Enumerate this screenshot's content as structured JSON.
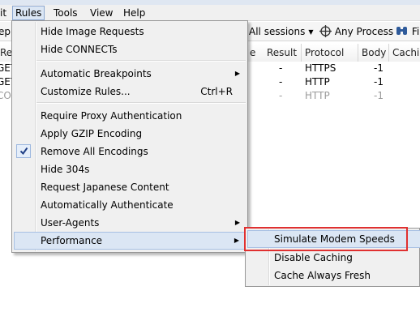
{
  "menubar": {
    "items": [
      {
        "label": "it"
      },
      {
        "label": "Rules"
      },
      {
        "label": "Tools"
      },
      {
        "label": "View"
      },
      {
        "label": "Help"
      }
    ]
  },
  "toolbar": {
    "left_fragment": "epl",
    "sessions_label": "All sessions",
    "any_process_label": "Any Process",
    "find_fragment": "Fi"
  },
  "grid": {
    "columns": [
      {
        "label": "Res"
      },
      {
        "label": "e"
      },
      {
        "label": "Result"
      },
      {
        "label": "Protocol"
      },
      {
        "label": "Body"
      },
      {
        "label": "Cachi"
      }
    ],
    "rows": [
      {
        "method": "GET",
        "result": "-",
        "protocol": "HTTPS",
        "body": "-1"
      },
      {
        "method": "GET",
        "result": "-",
        "protocol": "HTTP",
        "body": "-1"
      },
      {
        "method": "CON",
        "result": "-",
        "protocol": "HTTP",
        "body": "-1"
      }
    ]
  },
  "rules_menu": {
    "items": [
      {
        "label": "Hide Image Requests"
      },
      {
        "label": "Hide CONNECTs"
      },
      {
        "label": "Automatic Breakpoints"
      },
      {
        "label": "Customize Rules...",
        "shortcut": "Ctrl+R"
      },
      {
        "label": "Require Proxy Authentication"
      },
      {
        "label": "Apply GZIP Encoding"
      },
      {
        "label": "Remove All Encodings",
        "checked": true
      },
      {
        "label": "Hide 304s"
      },
      {
        "label": "Request Japanese Content"
      },
      {
        "label": "Automatically Authenticate"
      },
      {
        "label": "User-Agents"
      },
      {
        "label": "Performance"
      }
    ]
  },
  "performance_submenu": {
    "items": [
      {
        "label": "Simulate Modem Speeds"
      },
      {
        "label": "Disable Caching"
      },
      {
        "label": "Cache Always Fresh"
      }
    ]
  },
  "colors": {
    "highlight_border": "#e03030",
    "menu_hover": "#dbe6f4",
    "menu_bg": "#f0f0f0"
  }
}
